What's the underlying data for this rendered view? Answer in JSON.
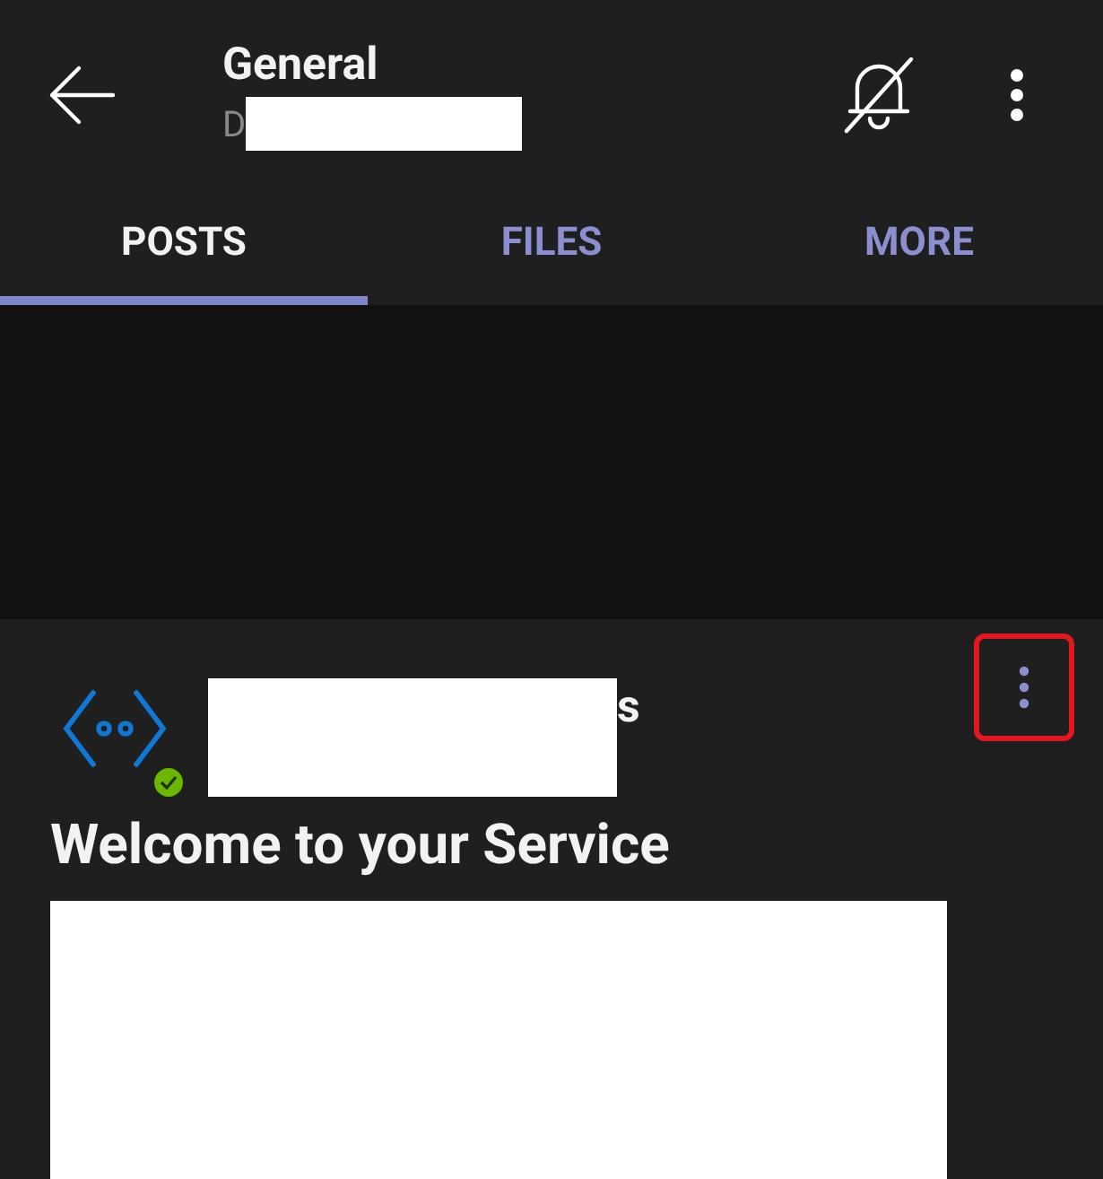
{
  "header": {
    "title": "General",
    "subtitle_visible": "D"
  },
  "tabs": [
    {
      "label": "POSTS",
      "selected": true
    },
    {
      "label": "FILES",
      "selected": false
    },
    {
      "label": "MORE",
      "selected": false
    }
  ],
  "post": {
    "author_visible": "s",
    "presence_dot": {
      "color": "#6bb700"
    },
    "highlighted_menu": true,
    "heading": "Welcome to your Service"
  }
}
